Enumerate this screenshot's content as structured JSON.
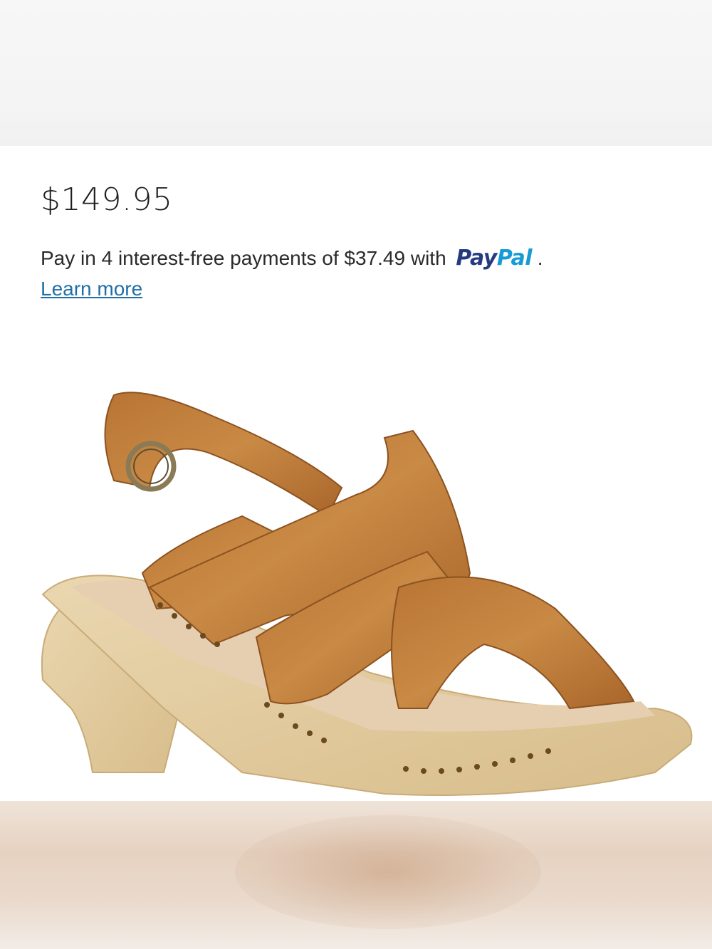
{
  "product": {
    "price": "$149.95",
    "installment_text": "Pay in 4 interest-free payments of $37.49 with",
    "paypal_brand_pay": "Pay",
    "paypal_brand_pal": "Pal",
    "period": ".",
    "learn_more_label": "Learn more",
    "image_icon": "sandal-product-image"
  },
  "colors": {
    "paypal_dark_blue": "#253b80",
    "paypal_light_blue": "#179bd7",
    "link_blue": "#1f6fa8",
    "leather": "#b87333"
  }
}
